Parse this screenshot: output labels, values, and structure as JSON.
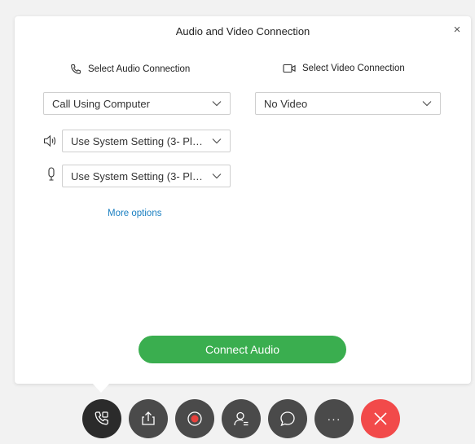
{
  "dialog": {
    "title": "Audio and Video Connection",
    "close_label": "×"
  },
  "audio": {
    "header": "Select Audio Connection",
    "connection_value": "Call Using Computer",
    "speaker_value": "Use System Setting (3- Plant...",
    "microphone_value": "Use System Setting (3- Plant..."
  },
  "video": {
    "header": "Select Video Connection",
    "connection_value": "No Video"
  },
  "more_options_label": "More options",
  "connect_button_label": "Connect Audio",
  "toolbar": {
    "buttons": [
      {
        "icon": "phone-settings-icon",
        "color": "#2b2b2b"
      },
      {
        "icon": "share-icon",
        "color": "#4a4a4a"
      },
      {
        "icon": "record-icon",
        "color": "#4a4a4a"
      },
      {
        "icon": "participants-icon",
        "color": "#4a4a4a"
      },
      {
        "icon": "chat-icon",
        "color": "#4a4a4a"
      },
      {
        "icon": "more-icon",
        "color": "#4a4a4a",
        "label": "···"
      },
      {
        "icon": "end-meeting-icon",
        "color": "#f24a4a"
      }
    ]
  },
  "colors": {
    "connect_green": "#3aae4f",
    "link_blue": "#1a7fc1",
    "end_red": "#f24a4a",
    "record_red": "#e8413c"
  }
}
